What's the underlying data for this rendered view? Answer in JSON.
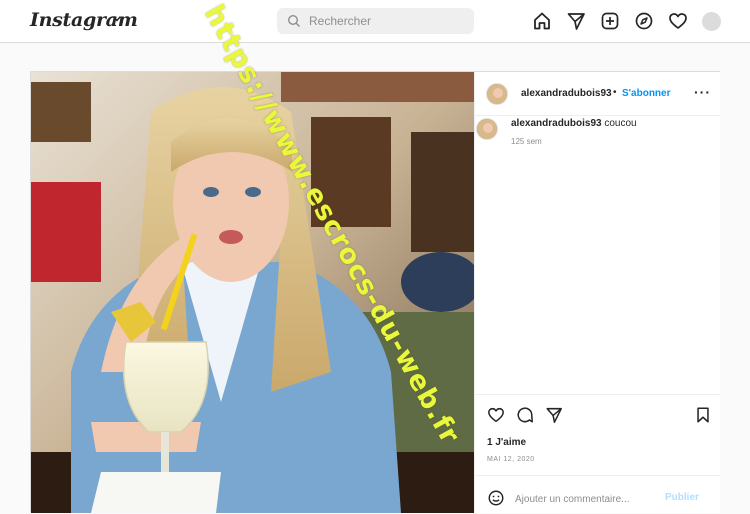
{
  "header": {
    "logo": "Instagram",
    "search_placeholder": "Rechercher"
  },
  "post": {
    "username": "alexandradubois93",
    "follow_label": "S'abonner",
    "more_label": "···",
    "caption_user": "alexandradubois93",
    "caption_text": "coucou",
    "caption_age": "125 sem",
    "likes": "1 J'aime",
    "date": "MAI 12, 2020",
    "comment_placeholder": "Ajouter un commentaire...",
    "publish_label": "Publier"
  },
  "watermark": "https://www.escrocs-du-web.fr",
  "colors": {
    "accent": "#0095f6",
    "publish_disabled": "#b2dffc",
    "watermark": "#e9f83a"
  },
  "icons": [
    "search-icon",
    "home-icon",
    "direct-icon",
    "new-post-icon",
    "explore-icon",
    "heart-icon",
    "comment-icon",
    "share-icon",
    "bookmark-icon",
    "emoji-icon",
    "chevron-down-icon"
  ]
}
